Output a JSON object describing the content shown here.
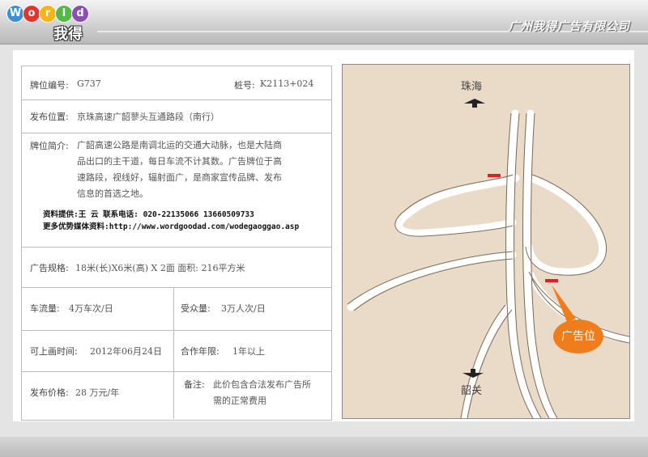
{
  "header": {
    "logo_letters": [
      "W",
      "o",
      "r",
      "l",
      "d"
    ],
    "logo_colors": [
      "#3a8fd6",
      "#e4342c",
      "#f6b417",
      "#57b84a",
      "#8a4fb5"
    ],
    "logo_cn": "我得",
    "company": "广州我得广告有限公司"
  },
  "info": {
    "code_label": "牌位编号:",
    "code_value": "G737",
    "stake_label": "桩号:",
    "stake_value": "K2113+024",
    "location_label": "发布位置:",
    "location_value": "京珠高速广韶蓼头互通路段（南行）",
    "intro_label": "牌位简介:",
    "intro_lines": [
      "广韶高速公路是南调北运的交通大动脉，也是大陆商",
      "品出口的主干道，每日车流不计其数。广告牌位于高",
      "速路段，视线好，辐射面广，是商家宣传品牌、发布",
      "信息的首选之地。"
    ],
    "contact_line1": "资料提供:王   云        联系电话: 020-22135066   13660509733",
    "contact_line2": "更多优势媒体资料:http://www.wordgoodad.com/wodegaoggao.asp",
    "spec_label": "广告规格:",
    "spec_value": "18米(长)X6米(高) X 2面   面积: 216平方米",
    "traffic_label": "车流量:",
    "traffic_value": "4万车次/日",
    "audience_label": "受众量:",
    "audience_value": "3万人次/日",
    "start_label": "可上画时间:",
    "start_value": "2012年06月24日",
    "term_label": "合作年限:",
    "term_value": "1年以上",
    "price_label": "发布价格:",
    "price_value": "28 万元/年",
    "note_label": "备注:",
    "note_line1": "此价包含合法发布广告所",
    "note_line2": "需的正常费用"
  },
  "map": {
    "north_label": "珠海",
    "south_label": "韶关",
    "callout": "广告位",
    "background": "#eadbc8",
    "marker_color": "#e02020",
    "callout_color": "#ef7d1c"
  }
}
